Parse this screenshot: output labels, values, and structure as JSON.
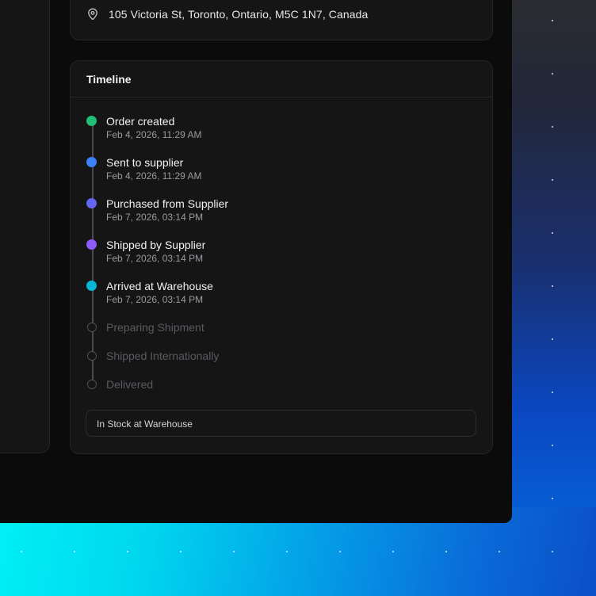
{
  "address": {
    "icon": "map-pin-icon",
    "text": "105 Victoria St, Toronto, Ontario, M5C 1N7, Canada"
  },
  "timeline": {
    "title": "Timeline",
    "steps": [
      {
        "label": "Order created",
        "time": "Feb 4, 2026, 11:29 AM",
        "status": "done",
        "color": "#1fbf75"
      },
      {
        "label": "Sent to supplier",
        "time": "Feb 4, 2026, 11:29 AM",
        "status": "done",
        "color": "#3b82f6"
      },
      {
        "label": "Purchased from Supplier",
        "time": "Feb 7, 2026, 03:14 PM",
        "status": "done",
        "color": "#6366f1"
      },
      {
        "label": "Shipped by Supplier",
        "time": "Feb 7, 2026, 03:14 PM",
        "status": "done",
        "color": "#8b5cf6"
      },
      {
        "label": "Arrived at Warehouse",
        "time": "Feb 7, 2026, 03:14 PM",
        "status": "done",
        "color": "#06b6d4"
      },
      {
        "label": "Preparing Shipment",
        "status": "pending"
      },
      {
        "label": "Shipped Internationally",
        "status": "pending"
      },
      {
        "label": "Delivered",
        "status": "pending"
      }
    ],
    "current_status": "In Stock at Warehouse"
  }
}
